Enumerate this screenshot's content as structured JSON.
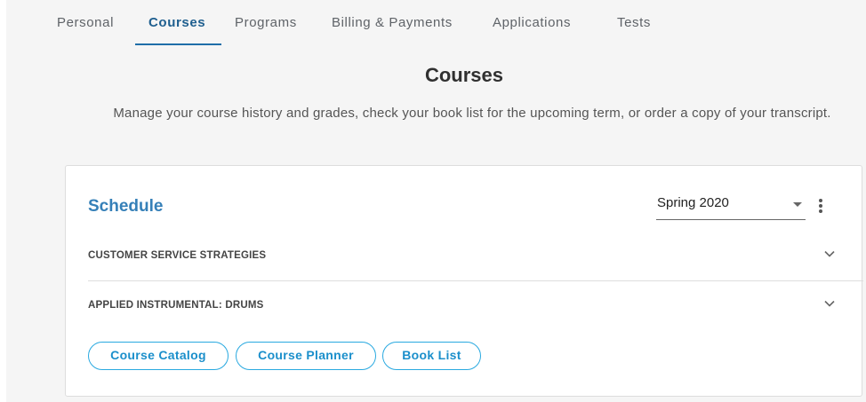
{
  "tabs": [
    {
      "label": "Personal"
    },
    {
      "label": "Courses"
    },
    {
      "label": "Programs"
    },
    {
      "label": "Billing & Payments"
    },
    {
      "label": "Applications"
    },
    {
      "label": "Tests"
    }
  ],
  "active_tab": "Courses",
  "header": {
    "title": "Courses",
    "description": "Manage your course history and grades, check your book list for the upcoming term, or order a copy of your transcript."
  },
  "schedule": {
    "title": "Schedule",
    "term": "Spring 2020",
    "courses": [
      {
        "name": "CUSTOMER SERVICE STRATEGIES"
      },
      {
        "name": "APPLIED INSTRUMENTAL: DRUMS"
      }
    ],
    "buttons": [
      {
        "label": "Course Catalog"
      },
      {
        "label": "Course Planner"
      },
      {
        "label": "Book List"
      }
    ]
  },
  "icons": {
    "term_dropdown": "caret-down-icon",
    "menu": "more-vertical-icon",
    "expand": "chevron-down-icon"
  },
  "colors": {
    "active_tab": "#1f5f8f",
    "card_title": "#3680b8",
    "button_outline": "#29a9e0",
    "page_background": "#f5f5f5"
  }
}
